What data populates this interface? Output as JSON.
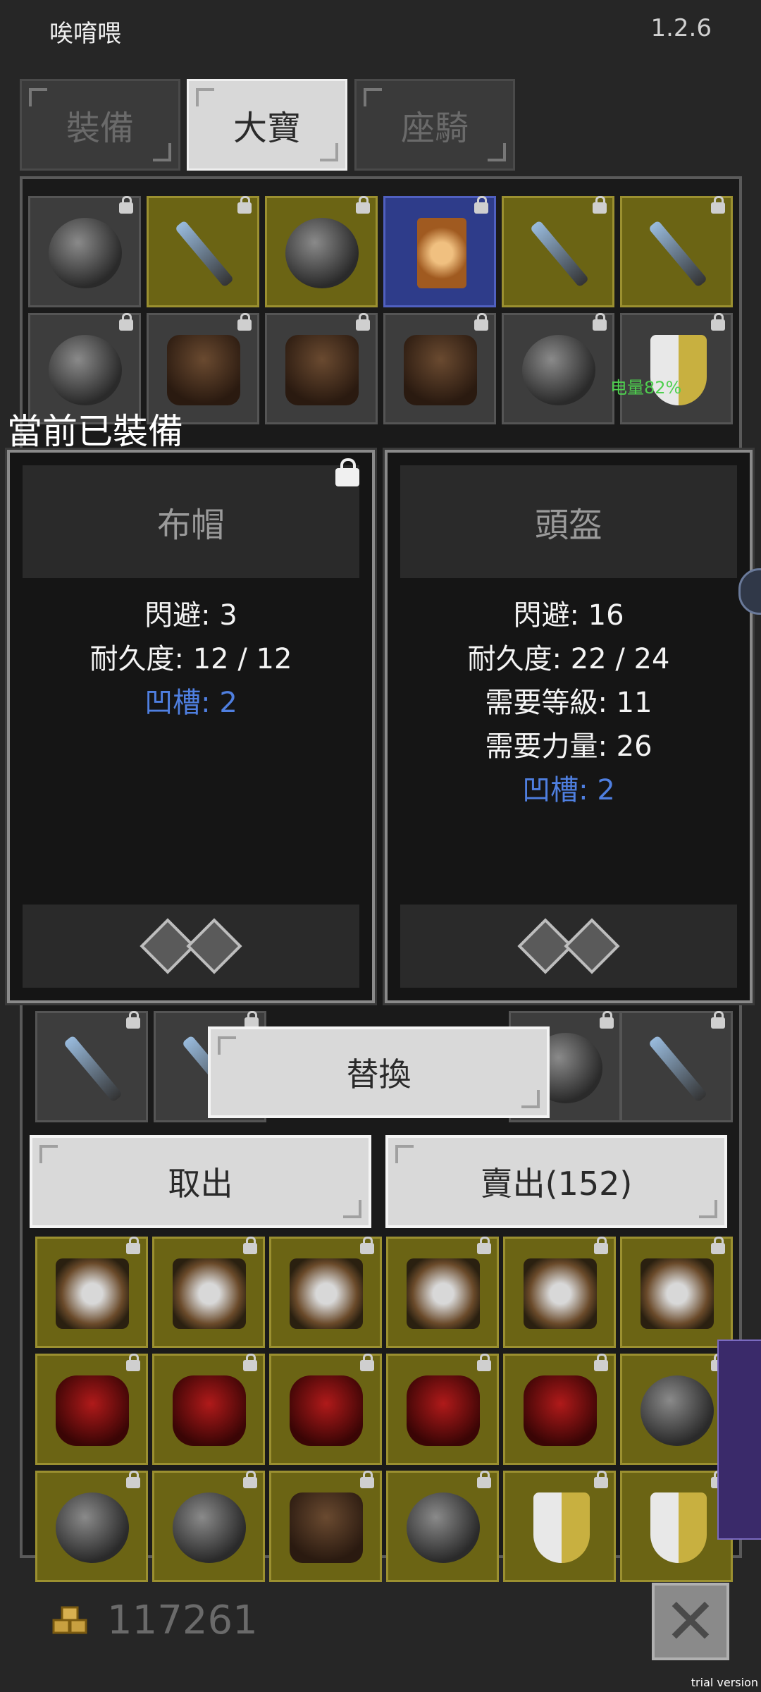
{
  "header": {
    "title": "唉唷喂",
    "version": "1.2.6"
  },
  "tabs": [
    {
      "label": "裝備",
      "active": false
    },
    {
      "label": "大寶",
      "active": true
    },
    {
      "label": "座騎",
      "active": false
    }
  ],
  "status": {
    "battery": "电量82%"
  },
  "overlay": {
    "label": "當前已裝備",
    "cards": [
      {
        "name": "布帽",
        "locked": true,
        "stats": [
          "閃避: 3",
          "耐久度: 12 / 12"
        ],
        "sockets_label": "凹槽: 2",
        "sockets": 2
      },
      {
        "name": "頭盔",
        "locked": false,
        "stats": [
          "閃避: 16",
          "耐久度: 22 / 24",
          "需要等級: 11",
          "需要力量: 26"
        ],
        "sockets_label": "凹槽: 2",
        "sockets": 2
      }
    ]
  },
  "actions": {
    "replace": "替換",
    "take_out": "取出",
    "sell": "賣出(152)"
  },
  "footer": {
    "gold": "117261"
  },
  "watermark": "trial version",
  "colors": {
    "accent_blue": "#4f7fe0",
    "rarity_yellow": "#6b6414",
    "rarity_blue": "#2e3c8a",
    "rarity_green": "#1f6a1f"
  }
}
